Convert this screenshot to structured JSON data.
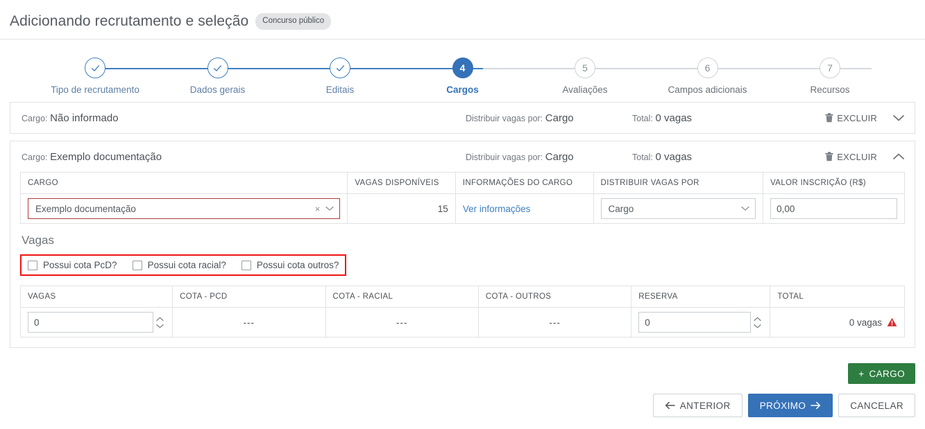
{
  "header": {
    "title": "Adicionando recrutamento e seleção",
    "badge": "Concurso público"
  },
  "stepper": {
    "steps": [
      {
        "num": "1",
        "label": "Tipo de recrutamento",
        "state": "done",
        "mark": "check"
      },
      {
        "num": "2",
        "label": "Dados gerais",
        "state": "done",
        "mark": "check"
      },
      {
        "num": "3",
        "label": "Editais",
        "state": "done",
        "mark": "check"
      },
      {
        "num": "4",
        "label": "Cargos",
        "state": "current",
        "mark": "4"
      },
      {
        "num": "5",
        "label": "Avaliações",
        "state": "todo",
        "mark": "5"
      },
      {
        "num": "6",
        "label": "Campos adicionais",
        "state": "todo",
        "mark": "6"
      },
      {
        "num": "7",
        "label": "Recursos",
        "state": "todo",
        "mark": "7"
      }
    ]
  },
  "cards": [
    {
      "cargo_label": "Cargo:",
      "cargo_value": "Não informado",
      "distribuir_label": "Distribuir vagas por:",
      "distribuir_value": "Cargo",
      "total_label": "Total:",
      "total_value": "0 vagas",
      "delete_label": "EXCLUIR",
      "expanded": false,
      "chevron": "chevron-down-icon"
    },
    {
      "cargo_label": "Cargo:",
      "cargo_value": "Exemplo documentação",
      "distribuir_label": "Distribuir vagas por:",
      "distribuir_value": "Cargo",
      "total_label": "Total:",
      "total_value": "0 vagas",
      "delete_label": "EXCLUIR",
      "expanded": true,
      "chevron": "chevron-up-icon"
    }
  ],
  "cargo_table": {
    "headers": [
      "CARGO",
      "VAGAS DISPONÍVEIS",
      "INFORMAÇÕES DO CARGO",
      "DISTRIBUIR VAGAS POR",
      "VALOR INSCRIÇÃO (R$)"
    ],
    "row": {
      "cargo_select_value": "Exemplo documentação",
      "cargo_clear": "×",
      "vagas_disponiveis": "15",
      "informacoes_link": "Ver informações",
      "distribuir_select_value": "Cargo",
      "valor_inscricao": "0,00"
    }
  },
  "vagas_section": {
    "title": "Vagas",
    "quotas": [
      {
        "label": "Possui cota PcD?",
        "checked": false
      },
      {
        "label": "Possui cota racial?",
        "checked": false
      },
      {
        "label": "Possui cota outros?",
        "checked": false
      }
    ],
    "headers": [
      "VAGAS",
      "COTA - PCD",
      "COTA - RACIAL",
      "COTA - OUTROS",
      "RESERVA",
      "TOTAL"
    ],
    "row": {
      "vagas": "0",
      "cota_pcd": "---",
      "cota_racial": "---",
      "cota_outros": "---",
      "reserva": "0",
      "total": "0 vagas",
      "total_has_warning": true
    }
  },
  "footer": {
    "add_cargo": "CARGO",
    "add_cargo_prefix": "+",
    "anterior": "ANTERIOR",
    "proximo": "PRÓXIMO",
    "cancelar": "CANCELAR"
  },
  "colors": {
    "accent_blue": "#3572b8",
    "step_blue": "#3f7fc1",
    "green": "#2e7d41",
    "error_red": "#b03a3a",
    "annotation_red": "#f01414",
    "warning_red": "#d32f2f",
    "border": "#dfe2e5",
    "text": "#4d5359"
  }
}
